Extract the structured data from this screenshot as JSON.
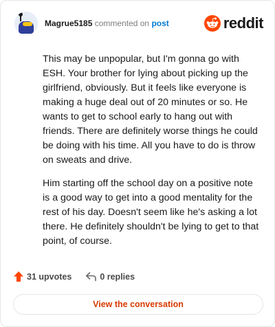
{
  "header": {
    "username": "Magrue5185",
    "action_text": "commented on",
    "target_link": "post",
    "brand": "reddit"
  },
  "comment": {
    "paragraphs": [
      "This may be unpopular, but I'm gonna go with ESH. Your brother for lying about picking up the girlfriend, obviously. But it feels like everyone is making a huge deal out of 20 minutes or so. He wants to get to school early to hang out with friends. There are definitely worse things he could be doing with his time. All you have to do is throw on sweats and drive.",
      "Him starting off the school day on a positive note is a good way to get into a good mentality for the rest of his day. Doesn't seem like he's asking a lot there. He definitely shouldn't be lying to get to that point, of course."
    ]
  },
  "stats": {
    "upvotes_label": "31 upvotes",
    "replies_label": "0 replies"
  },
  "cta": {
    "label": "View the conversation"
  },
  "colors": {
    "reddit_orange": "#ff4500",
    "link_blue": "#0079d3",
    "cta_text": "#d93a00",
    "text": "#1a1a1b",
    "muted": "#7c7c7c"
  },
  "icons": [
    "snoo-avatar",
    "reddit-logo-icon",
    "upvote-arrow-icon",
    "reply-arrow-icon"
  ]
}
